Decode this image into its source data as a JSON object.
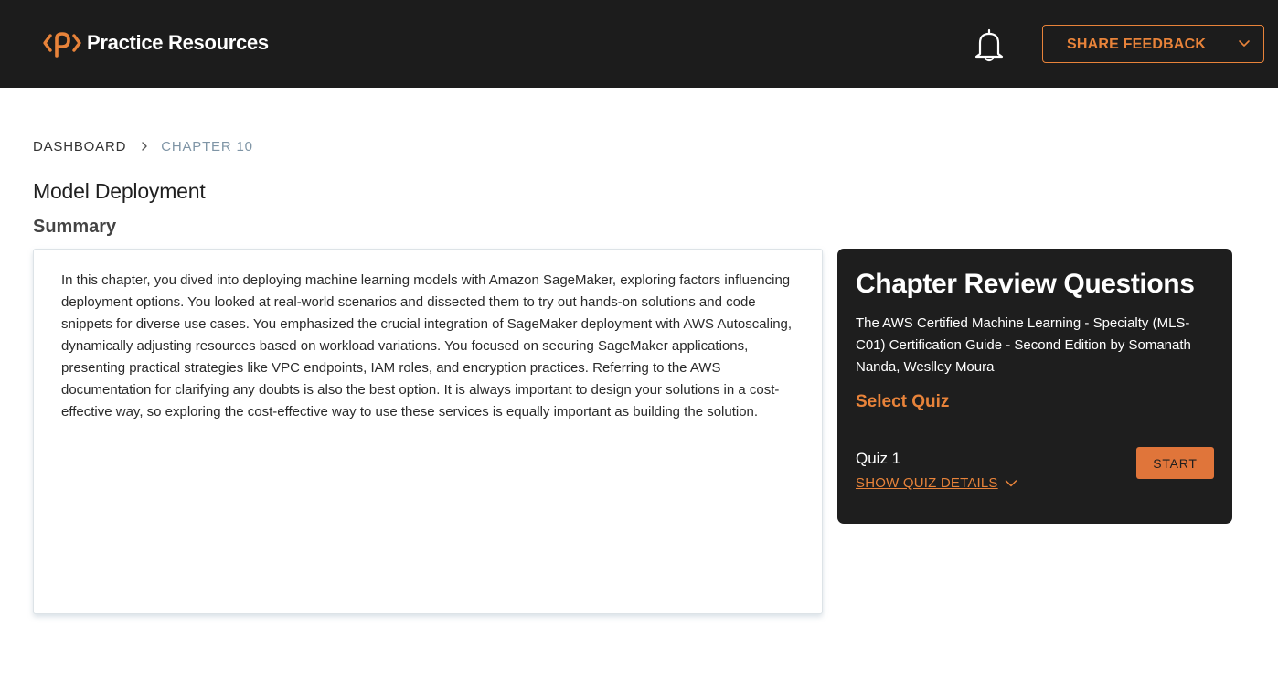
{
  "header": {
    "brand_name": "Practice Resources",
    "feedback_label": "SHARE FEEDBACK",
    "brand_color": "#e8833a",
    "background_color": "#1c1c1c"
  },
  "breadcrumb": {
    "items": [
      "DASHBOARD",
      "CHAPTER 10"
    ]
  },
  "page": {
    "title": "Model Deployment",
    "section": "Summary"
  },
  "summary": {
    "text": "In this chapter, you dived into deploying machine learning models with Amazon SageMaker, exploring factors influencing deployment options. You looked at real-world scenarios and dissected them to try out hands-on solutions and code snippets for diverse use cases. You emphasized the crucial integration of SageMaker deployment with AWS Autoscaling, dynamically adjusting resources based on workload variations. You focused on securing SageMaker applications, presenting practical strategies like VPC endpoints, IAM roles, and encryption practices. Referring to the AWS documentation for clarifying any doubts is also the best option. It is always important to design your solutions in a cost-effective way, so exploring the cost-effective way to use these services is equally important as building the solution."
  },
  "review": {
    "title": "Chapter Review Questions",
    "book": "The AWS Certified Machine Learning - Specialty (MLS-C01) Certification Guide - Second Edition by Somanath Nanda, Weslley Moura",
    "select_label": "Select Quiz",
    "quizzes": [
      {
        "name": "Quiz 1",
        "details_label": "SHOW QUIZ DETAILS",
        "start_label": "START"
      }
    ]
  },
  "icons": [
    "packt-logo-icon",
    "bell-icon",
    "chevron-down-icon",
    "chevron-right-icon"
  ]
}
